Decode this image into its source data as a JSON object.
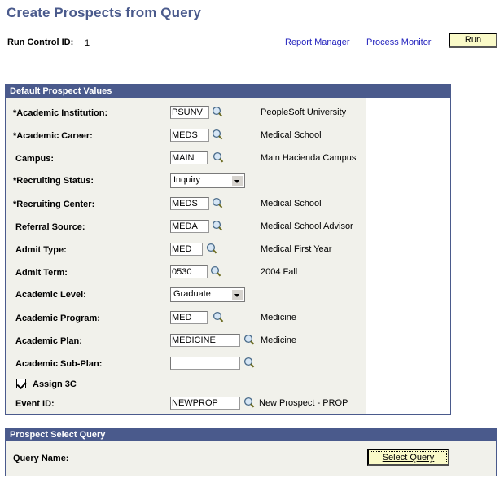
{
  "page": {
    "title": "Create Prospects from Query",
    "run_control_label": "Run Control ID:",
    "run_control_value": "1",
    "report_manager_link": "Report Manager",
    "process_monitor_link": "Process Monitor",
    "run_button": "Run"
  },
  "colors": {
    "title": "#4A5A8C",
    "panel_header_bg": "#4A5A8C",
    "panel_inner_bg": "#F1F1EB",
    "link": "#2323BE",
    "button_bg": "#FAFAC8"
  },
  "default_prospect_values": {
    "header": "Default Prospect Values",
    "fields": [
      {
        "label": "*Academic Institution:",
        "control": "edit",
        "value": "PSUNV",
        "description": "PeopleSoft University",
        "lookup_icon": "magnifier-icon"
      },
      {
        "label": "*Academic Career:",
        "control": "edit",
        "value": "MEDS",
        "description": "Medical School",
        "lookup_icon": "magnifier-icon"
      },
      {
        "label": "Campus:",
        "control": "edit",
        "value": "MAIN",
        "description": "Main Hacienda Campus",
        "lookup_icon": "magnifier-icon"
      },
      {
        "label": "*Recruiting Status:",
        "control": "dropdown",
        "value": "Inquiry",
        "description": "",
        "lookup_icon": ""
      },
      {
        "label": "*Recruiting Center:",
        "control": "edit",
        "value": "MEDS",
        "description": "Medical School",
        "lookup_icon": "magnifier-icon"
      },
      {
        "label": "Referral Source:",
        "control": "edit",
        "value": "MEDA",
        "description": "Medical School Advisor",
        "lookup_icon": "magnifier-icon"
      },
      {
        "label": "Admit Type:",
        "control": "edit",
        "value": "MED",
        "description": "Medical First Year",
        "lookup_icon": "magnifier-icon"
      },
      {
        "label": "Admit Term:",
        "control": "edit",
        "value": "0530",
        "description": "2004 Fall",
        "lookup_icon": "magnifier-icon"
      },
      {
        "label": "Academic Level:",
        "control": "dropdown",
        "value": "Graduate",
        "description": "",
        "lookup_icon": ""
      },
      {
        "label": "Academic Program:",
        "control": "edit",
        "value": "MED",
        "description": "Medicine",
        "lookup_icon": "magnifier-icon"
      },
      {
        "label": "Academic Plan:",
        "control": "edit",
        "value": "MEDICINE",
        "description": "Medicine",
        "lookup_icon": "magnifier-icon"
      },
      {
        "label": "Academic Sub-Plan:",
        "control": "edit",
        "value": "",
        "description": "",
        "lookup_icon": "magnifier-icon"
      }
    ],
    "assign_3c": {
      "label": "Assign 3C",
      "checked": true
    },
    "event": {
      "label": "Event ID:",
      "value": "NEWPROP",
      "description": "New Prospect - PROP",
      "lookup_icon": "magnifier-icon"
    }
  },
  "prospect_select_query": {
    "header": "Prospect Select Query",
    "query_name_label": "Query Name:",
    "select_query_button": "Select Query"
  }
}
